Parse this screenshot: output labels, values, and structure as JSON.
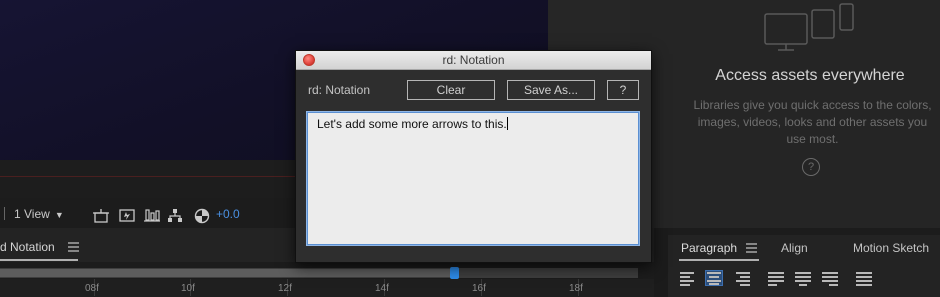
{
  "viewer_toolbar": {
    "view_select": "1 View",
    "zoom_value": "+0.0"
  },
  "libraries": {
    "title": "Access assets everywhere",
    "description": "Libraries give you quick access to the colors, images, videos, looks and other assets you use most.",
    "help_glyph": "?"
  },
  "timeline": {
    "tab_label": "d Notation",
    "tick_labels": [
      "08f",
      "10f",
      "12f",
      "14f",
      "16f",
      "18f"
    ]
  },
  "paragraph_panel": {
    "tabs": [
      "Paragraph",
      "Align",
      "Motion Sketch"
    ],
    "alignments": [
      "align-left-icon",
      "align-center-icon",
      "align-right-icon",
      "justify-last-left-icon",
      "justify-last-center-icon",
      "justify-last-right-icon",
      "justify-all-icon"
    ],
    "active_alignment": "align-center-icon"
  },
  "dialog": {
    "title": "rd: Notation",
    "label": "rd: Notation",
    "buttons": {
      "clear": "Clear",
      "save_as": "Save As...",
      "help": "?"
    },
    "note_text": "Let's add some more arrows to this."
  },
  "colors": {
    "accent": "#2d8ceb",
    "zoom_value": "#4a90e2",
    "close_button": "#e0443e"
  }
}
